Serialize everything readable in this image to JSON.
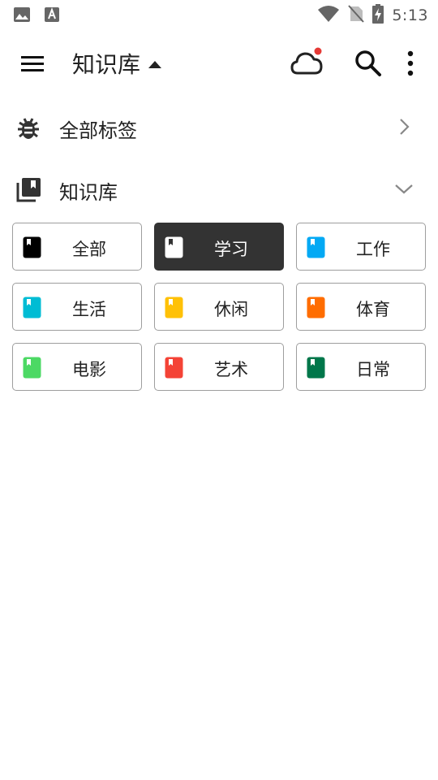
{
  "status_bar": {
    "time": "5:13",
    "icons": [
      "image-icon",
      "font-a-icon",
      "wifi-icon",
      "no-sim-icon",
      "battery-charging-icon"
    ]
  },
  "app_bar": {
    "title": "知识库",
    "icons": [
      "menu-icon",
      "caret-up-icon",
      "cloud-sync-icon",
      "search-icon",
      "more-vertical-icon"
    ],
    "notification_dot_color": "#e53935"
  },
  "tags_row": {
    "label": "全部标签",
    "icon": "bug-icon",
    "arrow": "chevron-right-icon"
  },
  "library_row": {
    "label": "知识库",
    "icon": "library-books-icon",
    "arrow": "chevron-down-icon"
  },
  "libraries": [
    {
      "label": "全部",
      "color": "#000000",
      "selected": false
    },
    {
      "label": "学习",
      "color": "#ffffff",
      "selected": true
    },
    {
      "label": "工作",
      "color": "#03a9f4",
      "selected": false
    },
    {
      "label": "生活",
      "color": "#00bcd4",
      "selected": false
    },
    {
      "label": "休闲",
      "color": "#ffc107",
      "selected": false
    },
    {
      "label": "体育",
      "color": "#ff6d00",
      "selected": false
    },
    {
      "label": "电影",
      "color": "#4cd964",
      "selected": false
    },
    {
      "label": "艺术",
      "color": "#f44336",
      "selected": false
    },
    {
      "label": "日常",
      "color": "#00774a",
      "selected": false
    }
  ]
}
